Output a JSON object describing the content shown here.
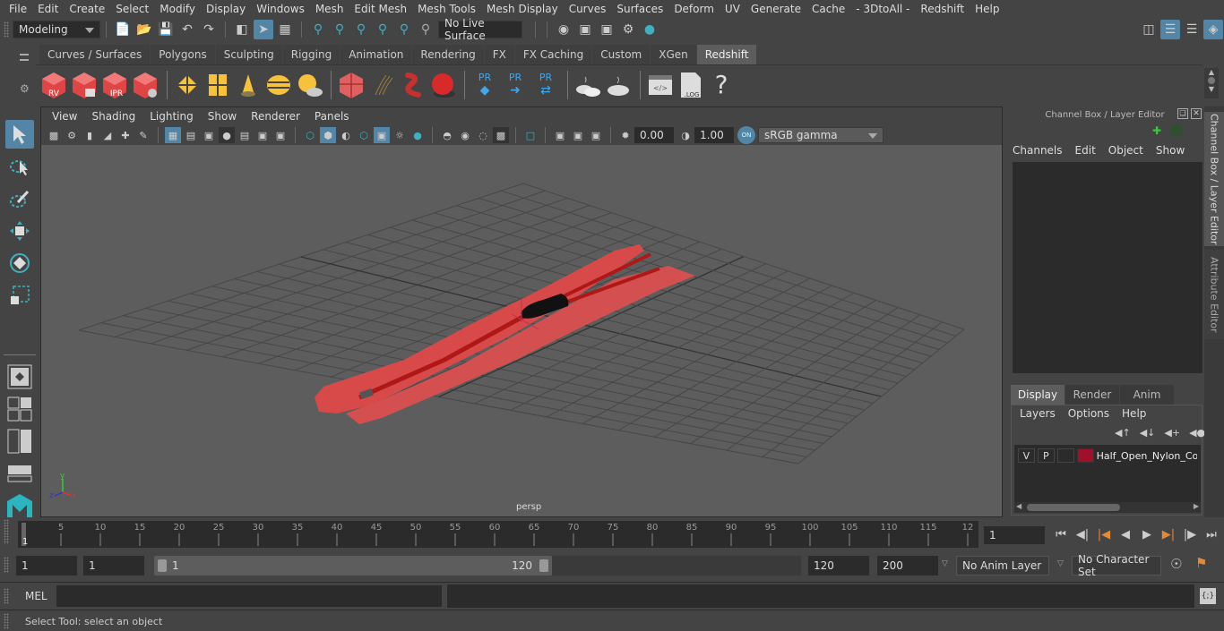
{
  "menubar": {
    "items": [
      "File",
      "Edit",
      "Create",
      "Select",
      "Modify",
      "Display",
      "Windows",
      "Mesh",
      "Edit Mesh",
      "Mesh Tools",
      "Mesh Display",
      "Curves",
      "Surfaces",
      "Deform",
      "UV",
      "Generate",
      "Cache",
      "- 3DtoAll -",
      "Redshift",
      "Help"
    ]
  },
  "statusline": {
    "workspace": "Modeling",
    "live_surface": "No Live Surface"
  },
  "shelf": {
    "tabs": [
      "Curves / Surfaces",
      "Polygons",
      "Sculpting",
      "Rigging",
      "Animation",
      "Rendering",
      "FX",
      "FX Caching",
      "Custom",
      "XGen",
      "Redshift"
    ],
    "active_tab": "Redshift",
    "icon_labels": {
      "rv": "RV",
      "ipr": "IPR",
      "pr": "PR",
      "log": ".LOG",
      "help": "?"
    }
  },
  "viewport": {
    "menus": [
      "View",
      "Shading",
      "Lighting",
      "Show",
      "Renderer",
      "Panels"
    ],
    "exposure": "0.00",
    "gamma": "1.00",
    "color_space": "sRGB gamma",
    "camera_label": "persp",
    "axis": {
      "x": "x",
      "y": "y",
      "z": "z"
    },
    "object_color": "#d84040"
  },
  "channel_box": {
    "title": "Channel Box / Layer Editor",
    "menus": [
      "Channels",
      "Edit",
      "Object",
      "Show"
    ]
  },
  "layer_editor": {
    "tabs": [
      "Display",
      "Render",
      "Anim"
    ],
    "active_tab": "Display",
    "menus": [
      "Layers",
      "Options",
      "Help"
    ],
    "layers": [
      {
        "v": "V",
        "p": "P",
        "color": "#a0102a",
        "name": "Half_Open_Nylon_Coil"
      }
    ]
  },
  "side_tabs": [
    "Channel Box / Layer Editor",
    "Attribute Editor"
  ],
  "timeline": {
    "ticks": [
      "5",
      "10",
      "15",
      "20",
      "25",
      "30",
      "35",
      "40",
      "45",
      "50",
      "55",
      "60",
      "65",
      "70",
      "75",
      "80",
      "85",
      "90",
      "95",
      "100",
      "105",
      "110",
      "115",
      "12"
    ],
    "current_frame_marker": "1",
    "current_frame": "1"
  },
  "range": {
    "start": "1",
    "playback_start": "1",
    "slider_start": "1",
    "slider_end": "120",
    "playback_end": "120",
    "end": "200",
    "anim_layer": "No Anim Layer",
    "character_set": "No Character Set"
  },
  "command_line": {
    "label": "MEL"
  },
  "help_line": {
    "text": "Select Tool: select an object"
  }
}
